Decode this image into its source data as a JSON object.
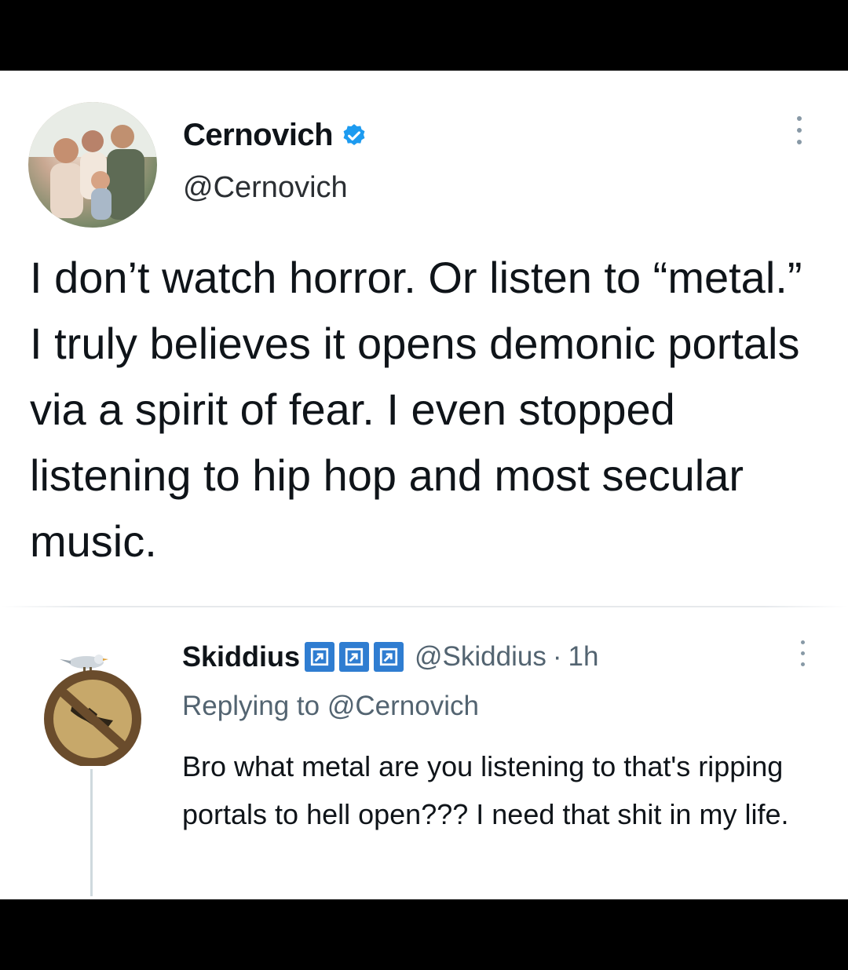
{
  "tweet": {
    "author_name": "Cernovich",
    "author_handle": "@Cernovich",
    "verified_icon": "verified-badge-icon",
    "text": "I don’t watch horror. Or listen to “metal.” I truly believes it opens demonic portals via a spirit of fear. I even stopped listening to hip hop and most secular music."
  },
  "reply": {
    "author_name": "Skiddius",
    "badge_icons": [
      "external-link-badge-icon",
      "external-link-badge-icon",
      "external-link-badge-icon"
    ],
    "author_handle": "@Skiddius",
    "separator": "·",
    "time": "1h",
    "replying_prefix": "Replying to",
    "replying_mention": "@Cernovich",
    "text": "Bro what metal are you listening to that's ripping portals to hell open??? I need that shit in my life."
  },
  "colors": {
    "verified": "#1d9bf0",
    "badge": "#2f7dd1",
    "secondary_text": "#536471",
    "primary_text": "#0f1419"
  }
}
